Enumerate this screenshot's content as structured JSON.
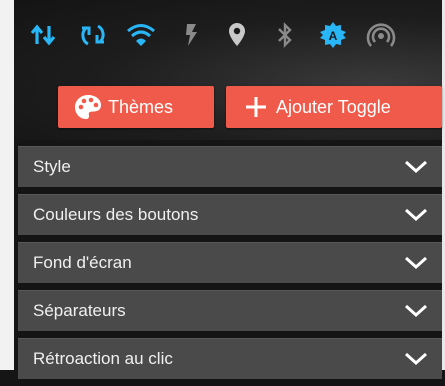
{
  "status_bar": {
    "icons": [
      "data-sync-icon",
      "rotation-icon",
      "wifi-icon",
      "flash-icon",
      "location-icon",
      "bluetooth-icon",
      "auto-brightness-icon",
      "hotspot-icon"
    ],
    "accent_color": "#29b6f6",
    "inactive_color": "#8a8a8a"
  },
  "actions": {
    "themes_label": "Thèmes",
    "add_toggle_label": "Ajouter Toggle",
    "button_color": "#f05a4a"
  },
  "sections": [
    {
      "label": "Style"
    },
    {
      "label": "Couleurs des boutons"
    },
    {
      "label": "Fond d'écran"
    },
    {
      "label": "Séparateurs"
    },
    {
      "label": "Rétroaction au clic"
    }
  ]
}
